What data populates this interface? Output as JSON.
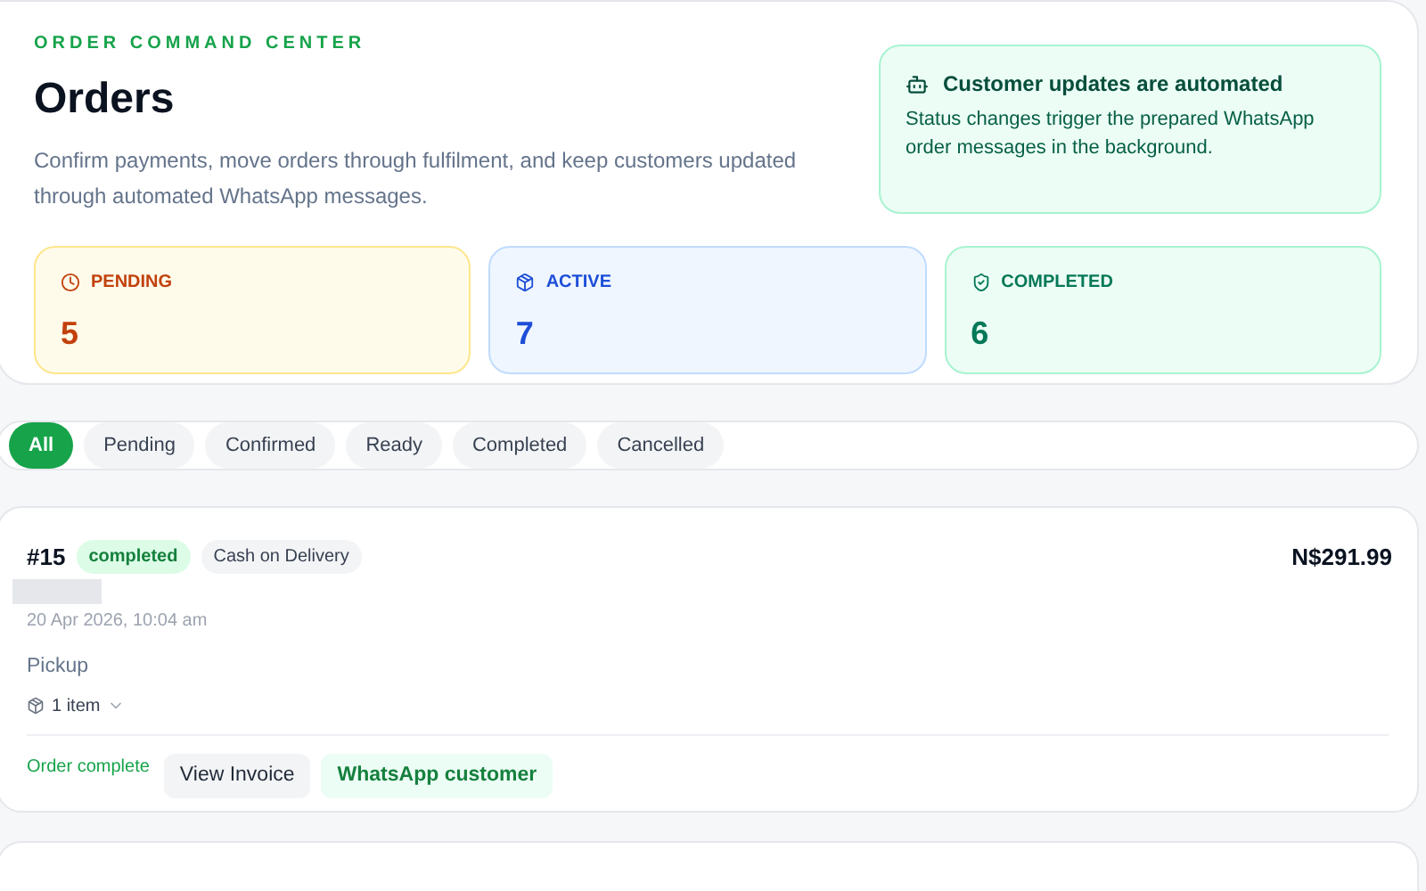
{
  "header": {
    "eyebrow": "ORDER COMMAND CENTER",
    "title": "Orders",
    "description": "Confirm payments, move orders through fulfilment, and keep customers updated through automated WhatsApp messages.",
    "notice": {
      "title": "Customer updates are automated",
      "text": "Status changes trigger the prepared WhatsApp order messages in the background."
    }
  },
  "stats": [
    {
      "kind": "pending",
      "label": "PENDING",
      "value": "5"
    },
    {
      "kind": "active",
      "label": "ACTIVE",
      "value": "7"
    },
    {
      "kind": "completed",
      "label": "COMPLETED",
      "value": "6"
    }
  ],
  "filters": [
    {
      "label": "All",
      "selected": true
    },
    {
      "label": "Pending",
      "selected": false
    },
    {
      "label": "Confirmed",
      "selected": false
    },
    {
      "label": "Ready",
      "selected": false
    },
    {
      "label": "Completed",
      "selected": false
    },
    {
      "label": "Cancelled",
      "selected": false
    }
  ],
  "orders": [
    {
      "number": "#15",
      "status": "completed",
      "payment": "Cash on Delivery",
      "date": "20 Apr 2026, 10:04 am",
      "fulfilment": "Pickup",
      "items": "1 item",
      "total": "N$291.99",
      "state_note": "Order complete",
      "actions": [
        "View Invoice",
        "WhatsApp customer"
      ]
    }
  ]
}
